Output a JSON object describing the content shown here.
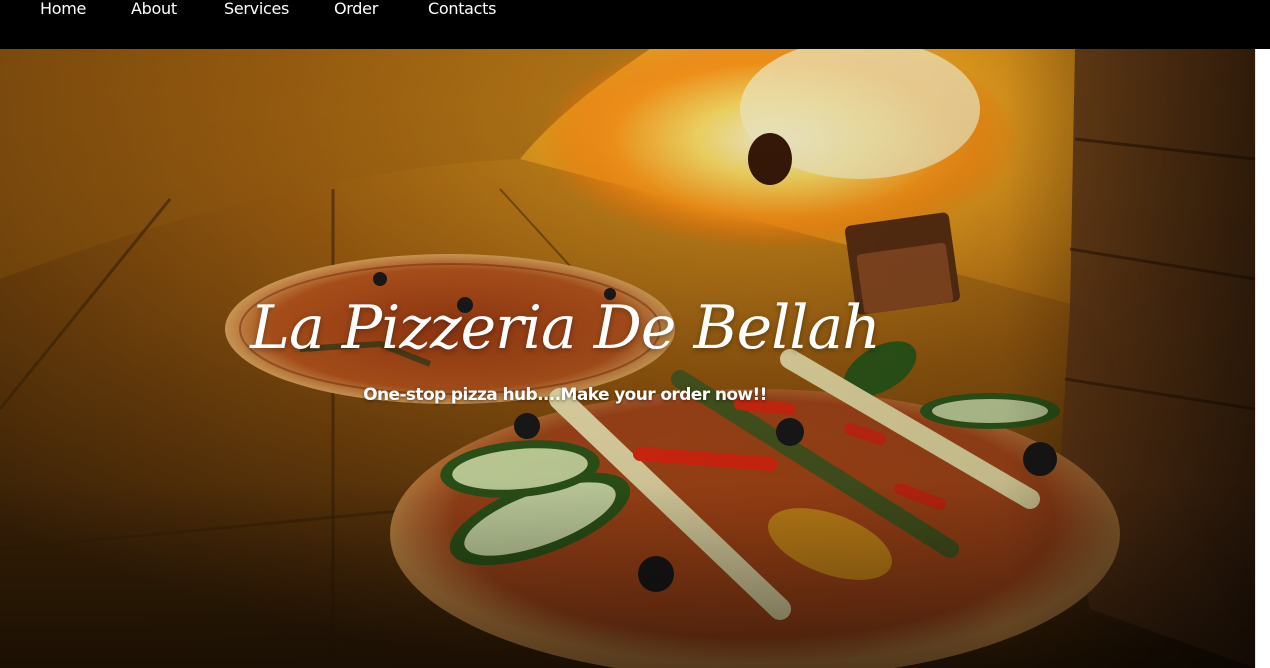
{
  "nav": {
    "items": [
      {
        "label": "Home"
      },
      {
        "label": "About"
      },
      {
        "label": "Services"
      },
      {
        "label": "Order"
      },
      {
        "label": "Contacts"
      }
    ]
  },
  "hero": {
    "title": "La Pizzeria De Bellah",
    "subtitle": "One-stop pizza hub....Make your order now!!",
    "background_image": "wood-fired-oven-with-pizzas",
    "colors": {
      "nav_background": "#000000",
      "nav_text": "#ffffff",
      "title_text": "#ffffff"
    }
  }
}
